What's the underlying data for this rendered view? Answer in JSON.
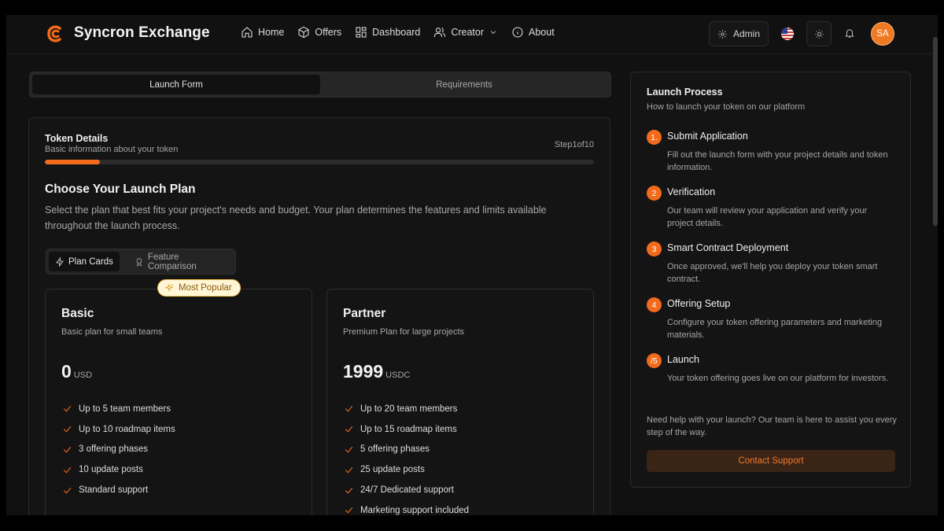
{
  "header": {
    "brand": "Syncron Exchange",
    "nav": [
      {
        "label": "Home",
        "icon": "home-icon"
      },
      {
        "label": "Offers",
        "icon": "box-icon"
      },
      {
        "label": "Dashboard",
        "icon": "grid-icon"
      },
      {
        "label": "Creator",
        "icon": "users-icon"
      },
      {
        "label": "About",
        "icon": "info-icon"
      }
    ],
    "admin_label": "Admin",
    "avatar_initials": "SA"
  },
  "tabs": [
    {
      "label": "Launch Form",
      "active": true
    },
    {
      "label": "Requirements",
      "active": false
    }
  ],
  "token_details": {
    "title": "Token Details",
    "subtitle": "Basic information about your token",
    "step_text": "Step1of10",
    "progress": 0.1
  },
  "plan_section": {
    "title": "Choose Your Launch Plan",
    "description": "Select the plan that best fits your project's needs and budget. Your plan determines the features and limits available throughout the launch process.",
    "view_toggle": [
      "Plan Cards",
      "Feature Comparison"
    ],
    "badge": "Most Popular"
  },
  "plans": [
    {
      "name": "Basic",
      "description": "Basic plan for small teams",
      "price": "0",
      "currency": "USD",
      "features": [
        "Up to 5 team members",
        "Up to 10 roadmap items",
        "3 offering phases",
        "10 update posts",
        "Standard support"
      ]
    },
    {
      "name": "Partner",
      "description": "Premium Plan for large projects",
      "price": "1999",
      "currency": "USDC",
      "features": [
        "Up to 20 team members",
        "Up to 15 roadmap items",
        "5 offering phases",
        "25 update posts",
        "24/7 Dedicated support",
        "Marketing support included"
      ]
    }
  ],
  "process": {
    "title": "Launch Process",
    "subtitle": "How to launch your token on our platform",
    "steps": [
      {
        "num": "1.",
        "title": "Submit Application",
        "desc": "Fill out the launch form with your project details and token information."
      },
      {
        "num": "2",
        "title": "Verification",
        "desc": "Our team will review your application and verify your project details."
      },
      {
        "num": "3",
        "title": "Smart Contract Deployment",
        "desc": "Once approved, we'll help you deploy your token smart contract."
      },
      {
        "num": "4",
        "title": "Offering Setup",
        "desc": "Configure your token offering parameters and marketing materials."
      },
      {
        "num": "/5",
        "title": "Launch",
        "desc": "Your token offering goes live on our platform for investors."
      }
    ],
    "help_text": "Need help with your launch? Our team is here to assist you every step of the way.",
    "contact_label": "Contact Support"
  },
  "colors": {
    "accent": "#f26a1b",
    "background": "#111111"
  }
}
